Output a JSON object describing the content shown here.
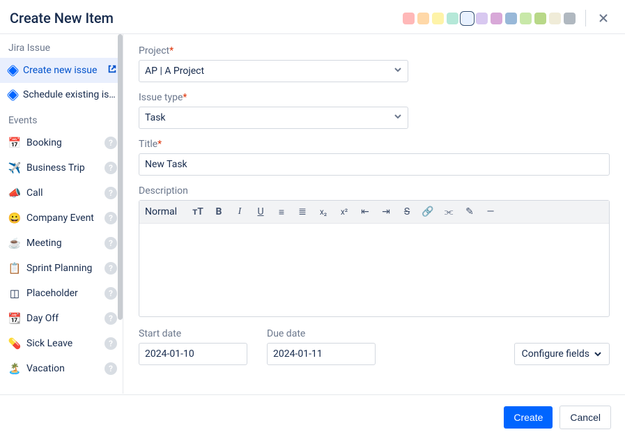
{
  "header": {
    "title": "Create New Item",
    "colors": [
      {
        "hex": "#FFB8B8",
        "selected": false
      },
      {
        "hex": "#FFD8A8",
        "selected": false
      },
      {
        "hex": "#FEF3A8",
        "selected": false
      },
      {
        "hex": "#B5E8D8",
        "selected": false
      },
      {
        "hex": "#E8F1FF",
        "selected": true
      },
      {
        "hex": "#D8C8F0",
        "selected": false
      },
      {
        "hex": "#D8A8D8",
        "selected": false
      },
      {
        "hex": "#98B8D8",
        "selected": false
      },
      {
        "hex": "#C8E8A8",
        "selected": false
      },
      {
        "hex": "#B8D888",
        "selected": false
      },
      {
        "hex": "#F0ECD8",
        "selected": false
      },
      {
        "hex": "#B0B8C0",
        "selected": false
      }
    ]
  },
  "sidebar": {
    "jira_heading": "Jira Issue",
    "jira_items": [
      {
        "label": "Create new issue",
        "active": true,
        "ext": true
      },
      {
        "label": "Schedule existing issue",
        "active": false,
        "ext": false
      }
    ],
    "events_heading": "Events",
    "event_items": [
      {
        "icon": "📅",
        "label": "Booking"
      },
      {
        "icon": "✈️",
        "label": "Business Trip"
      },
      {
        "icon": "📣",
        "label": "Call"
      },
      {
        "icon": "😀",
        "label": "Company Event"
      },
      {
        "icon": "☕",
        "label": "Meeting"
      },
      {
        "icon": "📋",
        "label": "Sprint Planning"
      },
      {
        "icon": "◫",
        "label": "Placeholder"
      },
      {
        "icon": "📆",
        "label": "Day Off"
      },
      {
        "icon": "💊",
        "label": "Sick Leave"
      },
      {
        "icon": "🏝️",
        "label": "Vacation"
      }
    ]
  },
  "form": {
    "project": {
      "label": "Project",
      "value": "AP | A Project"
    },
    "issue_type": {
      "label": "Issue type",
      "value": "Task"
    },
    "title": {
      "label": "Title",
      "value": "New Task"
    },
    "description": {
      "label": "Description",
      "toolbar_normal": "Normal"
    },
    "start_date": {
      "label": "Start date",
      "value": "2024-01-10"
    },
    "due_date": {
      "label": "Due date",
      "value": "2024-01-11"
    },
    "configure_fields": "Configure fields"
  },
  "footer": {
    "create": "Create",
    "cancel": "Cancel"
  }
}
